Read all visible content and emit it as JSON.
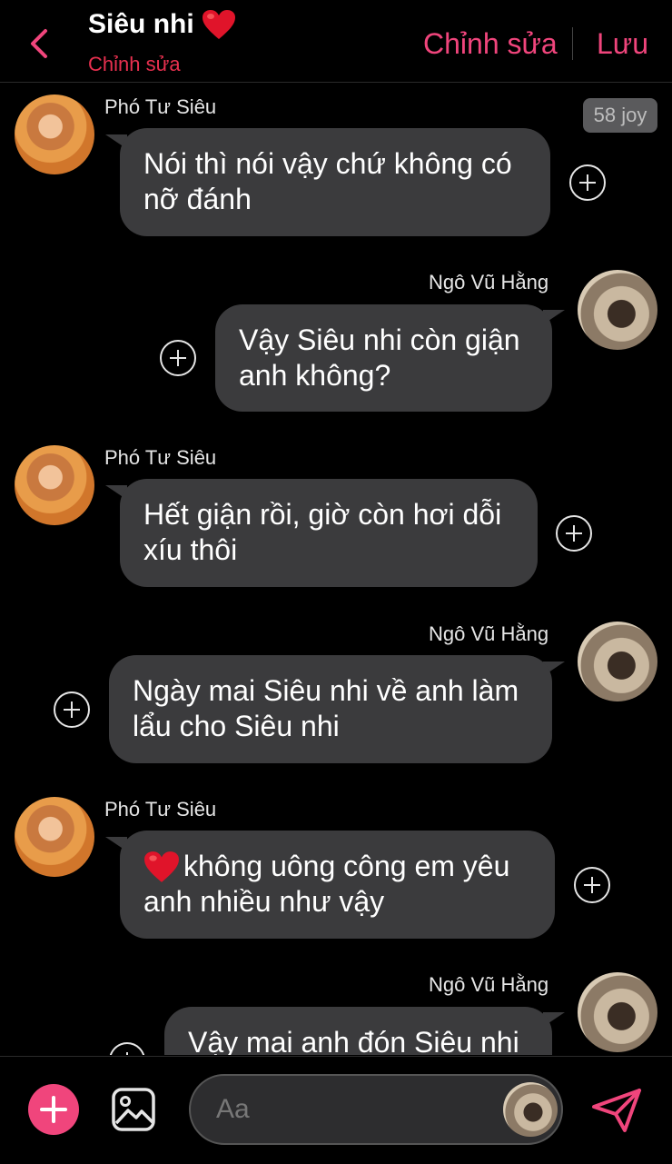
{
  "header": {
    "title": "Siêu nhi",
    "title_emoji": "heart",
    "subtitle": "Chỉnh sửa",
    "edit_label": "Chỉnh sửa",
    "save_label": "Lưu"
  },
  "badge": {
    "joy": "58 joy"
  },
  "messages": [
    {
      "sender": "Phó Tư Siêu",
      "side": "left",
      "line1": "Nói thì nói vậy chứ không có",
      "line2": "nỡ đánh"
    },
    {
      "sender": "Ngô Vũ Hằng",
      "side": "right",
      "line1": "Vậy Siêu nhi còn giận",
      "line2": "anh không?"
    },
    {
      "sender": "Phó Tư Siêu",
      "side": "left",
      "line1": "Hết giận rồi, giờ còn hơi dỗi",
      "line2": "xíu thôi"
    },
    {
      "sender": "Ngô Vũ Hằng",
      "side": "right",
      "line1": "Ngày mai Siêu nhi về anh làm",
      "line2": "lẩu cho Siêu nhi"
    },
    {
      "sender": "Phó Tư Siêu",
      "side": "left",
      "line1": "không uông công em yêu",
      "line2": "anh nhiều như vậy",
      "emoji": "heart"
    },
    {
      "sender": "Ngô Vũ Hằng",
      "side": "right",
      "line1": "Vậy mai anh đón Siêu nhi"
    }
  ],
  "composer": {
    "placeholder": "Aa"
  },
  "colors": {
    "accent": "#f0457c",
    "subtitle_red": "#e8304f",
    "bubble": "#3b3b3d",
    "background": "#000000"
  }
}
